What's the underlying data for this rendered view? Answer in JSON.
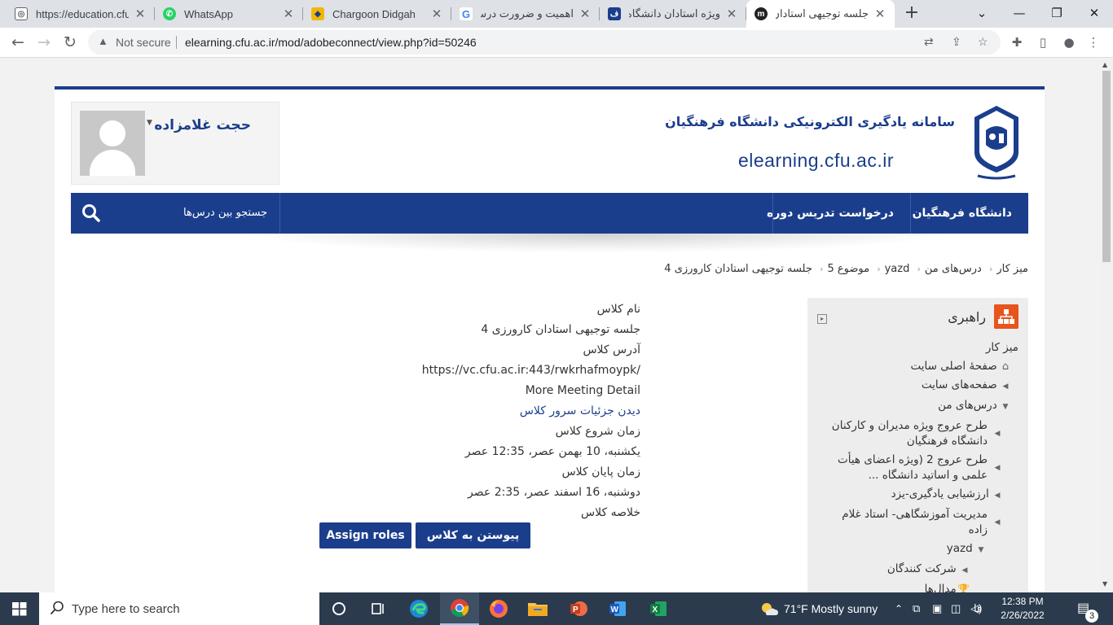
{
  "browser": {
    "tabs": [
      {
        "title": "https://education.cfu.a",
        "favicon": "globe-icon",
        "active": false
      },
      {
        "title": "WhatsApp",
        "favicon": "whatsapp-icon",
        "active": false
      },
      {
        "title": "Chargoon Didgah",
        "favicon": "chargoon-icon",
        "active": false
      },
      {
        "title": "اهمیت و ضرورت درس ...",
        "favicon": "google-icon",
        "active": false
      },
      {
        "title": "ویژه استادان دانشگاه ...",
        "favicon": "cfu-icon",
        "active": false
      },
      {
        "title": "جلسه توجیهی استادان ...",
        "favicon": "moodle-icon",
        "active": true
      }
    ],
    "security_label": "Not secure",
    "url": "elearning.cfu.ac.ir/mod/adobeconnect/view.php?id=50246"
  },
  "header": {
    "site_name": "سامانه یادگیری الکترونیکی دانشگاه فرهنگیان",
    "site_domain": "elearning.cfu.ac.ir",
    "user_name": "حجت غلامزاده"
  },
  "navbar": {
    "items": [
      "دانشگاه فرهنگیان",
      "درخواست تدریس دوره"
    ],
    "search_label": "جستجو بین درس‌ها"
  },
  "breadcrumb": [
    "میز کار",
    "درس‌های من",
    "yazd",
    "موضوع 5",
    "جلسه توجیهی استادان کارورزی 4"
  ],
  "navigation_block": {
    "title": "راهبری",
    "items": [
      "میز کار",
      "صفحهٔ اصلی سایت",
      "صفحه‌های سایت",
      "درس‌های من",
      "طرح عروج ویژه مدیران و کارکنان دانشگاه فرهنگیان",
      "طرح عروج 2 (ویژه اعضای هیأت علمی و اساتید دانشگاه ...",
      "ارزشیابی یادگیری-یزد",
      "مدیریت آموزشگاهی- استاد غلام زاده",
      "yazd",
      "شرکت کنندگان",
      "مدال‌ها"
    ]
  },
  "meeting": {
    "class_name_label": "نام کلاس",
    "class_name": "جلسه توجیهی استادان کارورزی 4",
    "class_address_label": "آدرس کلاس",
    "class_address": "https://vc.cfu.ac.ir:443/rwkrhafmoypk/",
    "more_detail": "More Meeting Detail",
    "server_detail_link": "دیدن جزئیات سرور کلاس",
    "start_label": "زمان شروع کلاس",
    "start_time": "یکشنبه، 10 بهمن عصر، 12:35 عصر",
    "end_label": "زمان پایان کلاس",
    "end_time": "دوشنبه، 16 اسفند عصر، 2:35 عصر",
    "summary_label": "خلاصه کلاس",
    "join_button": "پیوستن به کلاس",
    "assign_roles_button": "Assign roles"
  },
  "taskbar": {
    "search_placeholder": "Type here to search",
    "weather": "71°F  Mostly sunny",
    "language": "فا",
    "time": "12:38 PM",
    "date": "2/26/2022",
    "notification_count": "3"
  },
  "colors": {
    "brand_blue": "#1b3e8c",
    "block_icon": "#e8541b",
    "taskbar": "#2b3a4d"
  }
}
